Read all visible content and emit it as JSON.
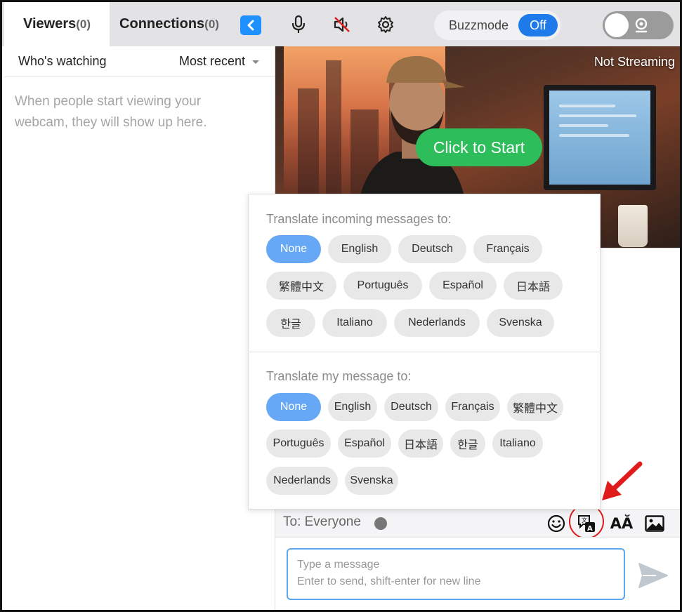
{
  "header": {
    "tab_viewers_label": "Viewers",
    "tab_viewers_count": "(0)",
    "tab_connections_label": "Connections",
    "tab_connections_count": "(0)",
    "buzzmode_label": "Buzzmode",
    "buzzmode_state": "Off"
  },
  "viewers": {
    "filter_label": "Who's watching",
    "sort_label": "Most recent",
    "empty_message": "When people start viewing your webcam, they will show up here."
  },
  "video": {
    "status": "Not Streaming",
    "start_button": "Click to Start"
  },
  "translate_popup": {
    "incoming_title": "Translate incoming messages to:",
    "incoming_options": [
      "None",
      "English",
      "Deutsch",
      "Français",
      "繁體中文",
      "Português",
      "Español",
      "日本語",
      "한글",
      "Italiano",
      "Nederlands",
      "Svenska"
    ],
    "incoming_selected": "None",
    "outgoing_title": "Translate my message to:",
    "outgoing_options": [
      "None",
      "English",
      "Deutsch",
      "Français",
      "繁體中文",
      "Português",
      "Español",
      "日本語",
      "한글",
      "Italiano",
      "Nederlands",
      "Svenska"
    ],
    "outgoing_selected": "None"
  },
  "chat": {
    "recipient_label": "To: Everyone",
    "font_button_label": "AĂ",
    "message_placeholder_line1": "Type a message",
    "message_placeholder_line2": "Enter to send, shift-enter for new line"
  },
  "colors": {
    "accent_blue": "#1e7be9",
    "selected_chip": "#66a8f5",
    "start_green": "#2dbe5b",
    "annotation_red": "#e01b1b"
  },
  "icons": [
    "chevron-left-icon",
    "microphone-icon",
    "speaker-muted-icon",
    "gear-icon",
    "webcam-icon",
    "emoji-icon",
    "translate-icon",
    "image-icon",
    "send-icon",
    "annotation-arrow-icon"
  ]
}
